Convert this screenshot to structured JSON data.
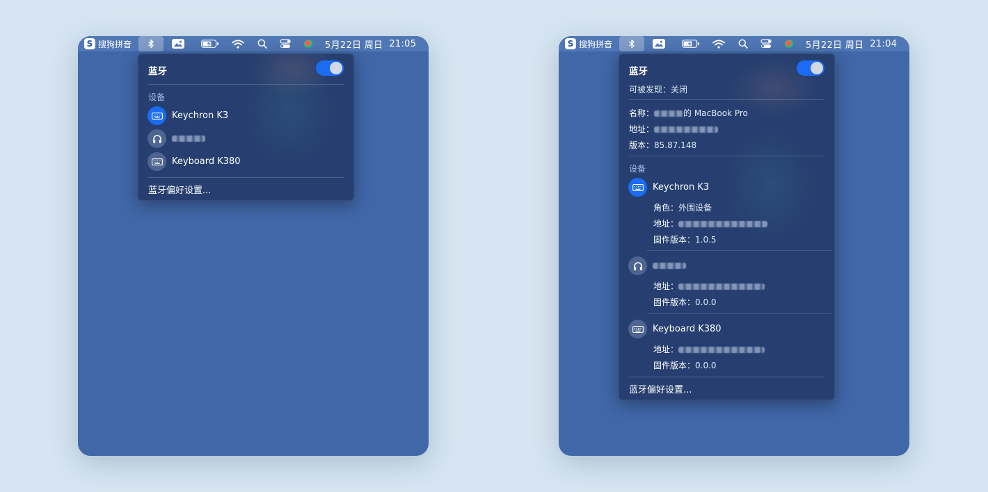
{
  "colors": {
    "background": "#d6e5f1",
    "desktop": "#4067a8",
    "accent": "#1b6cf2",
    "popup": "#263f70"
  },
  "left": {
    "menubar": {
      "ime_label": "搜狗拼音",
      "ime_logo": "S",
      "date": "5月22日 周日",
      "time": "21:05"
    },
    "popup": {
      "title": "蓝牙",
      "toggle_on": true,
      "section_devices": "设备",
      "devices": [
        {
          "name": "Keychron K3",
          "icon": "keyboard-icon",
          "active": true
        },
        {
          "name": "",
          "icon": "headphones-icon",
          "active": false
        },
        {
          "name": "Keyboard K380",
          "icon": "keyboard-icon",
          "active": false
        }
      ],
      "prefs_label": "蓝牙偏好设置..."
    }
  },
  "right": {
    "menubar": {
      "ime_label": "搜狗拼音",
      "ime_logo": "S",
      "date": "5月22日 周日",
      "time": "21:04"
    },
    "popup": {
      "title": "蓝牙",
      "toggle_on": true,
      "discoverable": "可被发现：关闭",
      "name_label": "名称：",
      "name_suffix": "的 MacBook Pro",
      "address_label": "地址：",
      "version_label": "版本：",
      "version_value": "85.87.148",
      "section_devices": "设备",
      "devices": [
        {
          "name": "Keychron K3",
          "icon": "keyboard-icon",
          "active": true,
          "role_label": "角色：",
          "role_value": "外围设备",
          "address_label": "地址：",
          "firmware_label": "固件版本：",
          "firmware_value": "1.0.5"
        },
        {
          "name": "",
          "icon": "headphones-icon",
          "active": false,
          "address_label": "地址：",
          "firmware_label": "固件版本：",
          "firmware_value": "0.0.0"
        },
        {
          "name": "Keyboard K380",
          "icon": "keyboard-icon",
          "active": false,
          "address_label": "地址：",
          "firmware_label": "固件版本：",
          "firmware_value": "0.0.0"
        }
      ],
      "prefs_label": "蓝牙偏好设置..."
    }
  }
}
